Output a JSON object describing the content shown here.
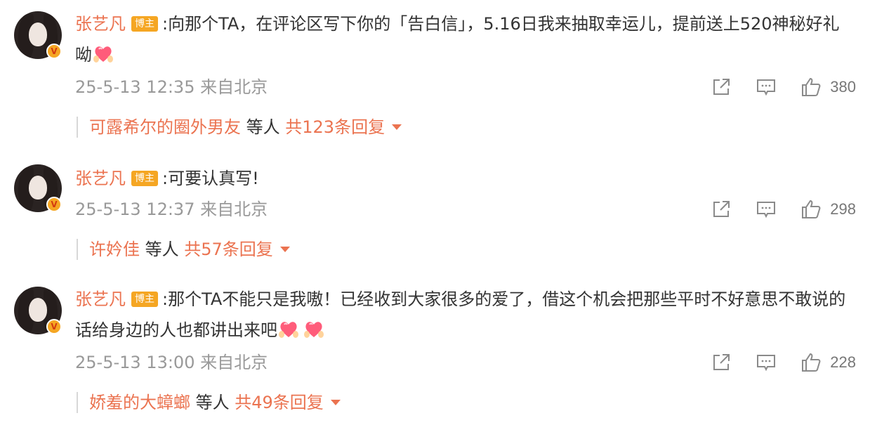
{
  "colors": {
    "accent": "#eb7350",
    "tag_bg": "#f5a623",
    "meta": "#999999"
  },
  "comments": [
    {
      "author": "张艺凡",
      "tag": "博主",
      "text": ":向那个TA，在评论区写下你的「告白信」，5.16日我来抽取幸运儿，提前送上520神秘好礼呦",
      "emojis": [
        "heart-hands-icon"
      ],
      "time": "25-5-13 12:35",
      "location": "来自北京",
      "likes": "380",
      "reply_name": "可露希尔的圈外男友",
      "reply_middle": " 等人 ",
      "reply_count": "共123条回复"
    },
    {
      "author": "张艺凡",
      "tag": "博主",
      "text": ":可要认真写!",
      "emojis": [],
      "time": "25-5-13 12:37",
      "location": "来自北京",
      "likes": "298",
      "reply_name": "许妗佳",
      "reply_middle": " 等人 ",
      "reply_count": "共57条回复"
    },
    {
      "author": "张艺凡",
      "tag": "博主",
      "text": ":那个TA不能只是我嗷！已经收到大家很多的爱了，借这个机会把那些平时不好意思不敢说的话给身边的人也都讲出来吧",
      "emojis": [
        "heart-hands-icon",
        "heart-hands-icon"
      ],
      "time": "25-5-13 13:00",
      "location": "来自北京",
      "likes": "228",
      "reply_name": "娇羞的大蟑螂",
      "reply_middle": " 等人 ",
      "reply_count": "共49条回复"
    }
  ]
}
